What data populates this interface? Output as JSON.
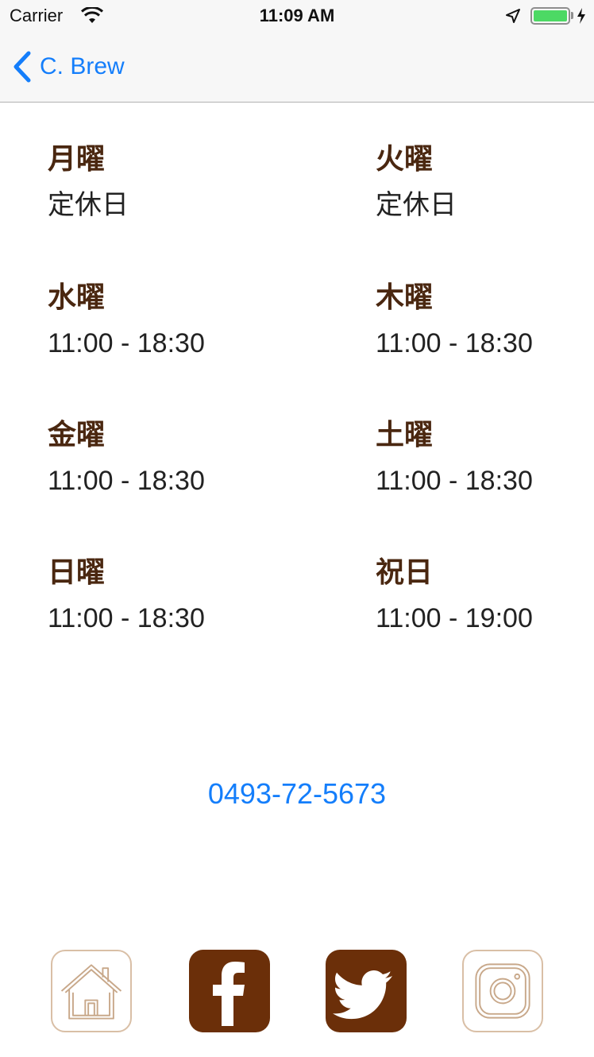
{
  "status_bar": {
    "carrier": "Carrier",
    "time": "11:09 AM"
  },
  "nav": {
    "back_label": "C. Brew"
  },
  "schedule": [
    {
      "day": "月曜",
      "hours": "定休日"
    },
    {
      "day": "火曜",
      "hours": "定休日"
    },
    {
      "day": "水曜",
      "hours": "11:00 - 18:30"
    },
    {
      "day": "木曜",
      "hours": "11:00 - 18:30"
    },
    {
      "day": "金曜",
      "hours": "11:00 - 18:30"
    },
    {
      "day": "土曜",
      "hours": "11:00 - 18:30"
    },
    {
      "day": "日曜",
      "hours": "11:00 - 18:30"
    },
    {
      "day": "祝日",
      "hours": "11:00 - 19:00"
    }
  ],
  "phone": "0493-72-5673",
  "social": [
    {
      "icon": "home-icon"
    },
    {
      "icon": "facebook-icon"
    },
    {
      "icon": "twitter-icon"
    },
    {
      "icon": "instagram-icon"
    }
  ],
  "colors": {
    "accent": "#147efb",
    "brand_brown": "#6b2f09",
    "day_label": "#4a2710",
    "outline": "#d9bfa6",
    "battery": "#4cd964"
  }
}
